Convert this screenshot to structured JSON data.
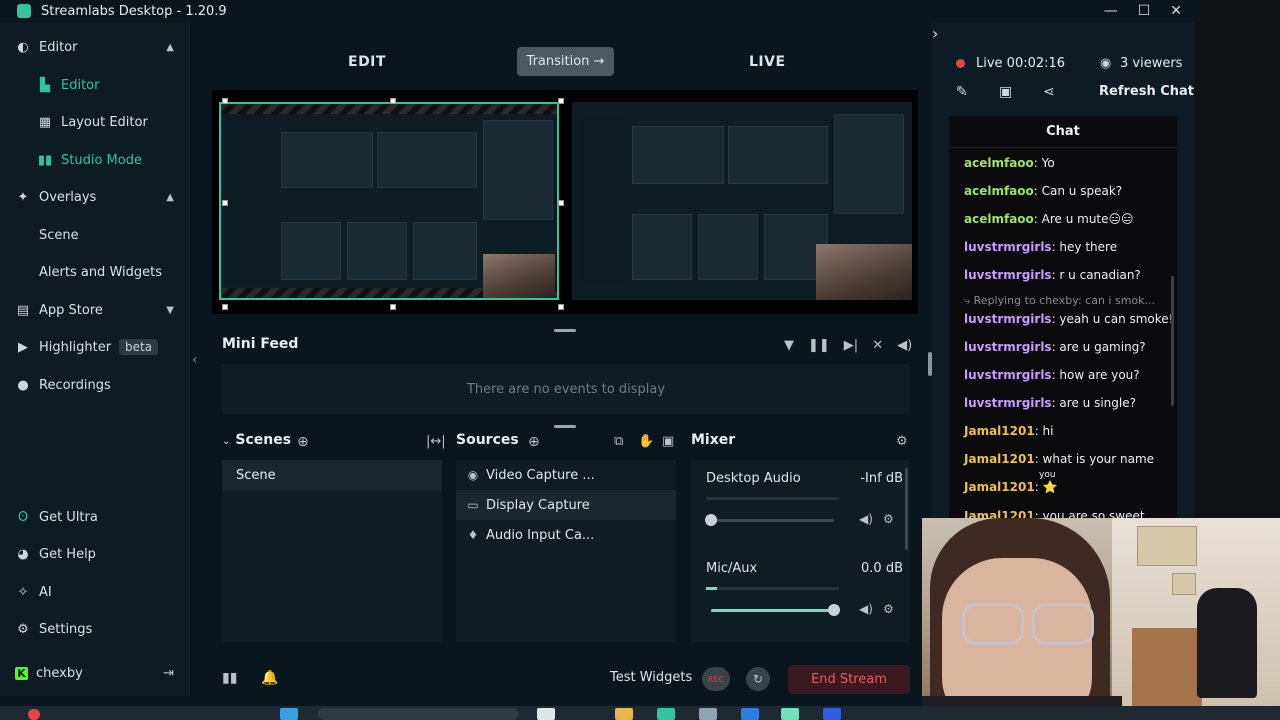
{
  "window": {
    "title": "Streamlabs Desktop - 1.20.9",
    "controls": [
      "minimize",
      "maximize",
      "close"
    ]
  },
  "nav": {
    "items": [
      {
        "label": "Editor",
        "icon": "palette-icon",
        "expanded": true
      },
      {
        "label": "Editor",
        "icon": "editor-icon",
        "sub": true,
        "active": true
      },
      {
        "label": "Layout Editor",
        "icon": "layout-icon",
        "sub": true
      },
      {
        "label": "Studio Mode",
        "icon": "studio-mode-icon",
        "sub": true,
        "active": true
      },
      {
        "label": "Overlays",
        "icon": "overlays-icon",
        "expanded": true
      },
      {
        "label": "Scene",
        "sub": true
      },
      {
        "label": "Alerts and Widgets",
        "sub": true
      },
      {
        "label": "App Store",
        "icon": "store-icon",
        "expanded": false
      },
      {
        "label": "Highlighter",
        "icon": "highlighter-icon",
        "badge": "beta"
      },
      {
        "label": "Recordings",
        "icon": "recordings-icon"
      }
    ],
    "bottom": [
      {
        "label": "Get Ultra",
        "icon": "ultra-icon"
      },
      {
        "label": "Get Help",
        "icon": "help-icon"
      },
      {
        "label": "AI",
        "icon": "ai-icon"
      },
      {
        "label": "Settings",
        "icon": "settings-icon"
      },
      {
        "label": "chexby",
        "icon": "kick-icon"
      }
    ]
  },
  "studio": {
    "edit_label": "EDIT",
    "live_label": "LIVE",
    "transition_label": "Transition →"
  },
  "minifeed": {
    "title": "Mini Feed",
    "empty": "There are no events to display"
  },
  "scenes": {
    "title": "Scenes",
    "items": [
      "Scene"
    ]
  },
  "sources": {
    "title": "Sources",
    "items": [
      {
        "label": "Video Capture ...",
        "icon": "webcam-icon"
      },
      {
        "label": "Display Capture",
        "icon": "monitor-icon",
        "selected": true
      },
      {
        "label": "Audio Input Ca...",
        "icon": "microphone-icon"
      }
    ]
  },
  "mixer": {
    "title": "Mixer",
    "channels": [
      {
        "name": "Desktop Audio",
        "db": "-Inf dB",
        "volume": 0.0
      },
      {
        "name": "Mic/Aux",
        "db": "0.0 dB",
        "volume": 1.0
      }
    ]
  },
  "statusbar": {
    "test_widgets": "Test Widgets",
    "rec_label": "REC",
    "end_stream": "End Stream"
  },
  "live": {
    "time": "Live 00:02:16",
    "viewers": "3 viewers",
    "refresh_chat": "Refresh Chat"
  },
  "chat": {
    "title": "Chat",
    "messages": [
      {
        "user": "acelmfaoo",
        "text": "Yo",
        "color": "#9ee36a"
      },
      {
        "user": "acelmfaoo",
        "text": "Can u speak?",
        "color": "#9ee36a"
      },
      {
        "user": "acelmfaoo",
        "text": "Are u mute😑😑",
        "color": "#9ee36a"
      },
      {
        "user": "luvstrmrgirls",
        "text": "hey there",
        "color": "#c79cff"
      },
      {
        "user": "luvstrmrgirls",
        "text": "r u canadian?",
        "color": "#c79cff"
      },
      {
        "reply": "Replying to chexby: can i smok..."
      },
      {
        "user": "luvstrmrgirls",
        "text": "yeah u can smoke!",
        "color": "#c79cff"
      },
      {
        "user": "luvstrmrgirls",
        "text": "are u gaming?",
        "color": "#c79cff"
      },
      {
        "user": "luvstrmrgirls",
        "text": "how are you?",
        "color": "#c79cff"
      },
      {
        "user": "luvstrmrgirls",
        "text": "are u single?",
        "color": "#c79cff"
      },
      {
        "user": "Jamal1201",
        "text": "hi",
        "color": "#f0c04a"
      },
      {
        "user": "Jamal1201",
        "text": "what is your name",
        "color": "#f0c04a"
      },
      {
        "user": "Jamal1201",
        "text": "⭐",
        "color": "#f0c04a"
      },
      {
        "user": "Jamal1201",
        "text": "you are so sweet",
        "color": "#f0c04a"
      }
    ],
    "emote_caption": "you"
  },
  "colors": {
    "accent": "#31c3a2",
    "end_stream": "#ef5b5b",
    "live_dot": "#e04848"
  }
}
